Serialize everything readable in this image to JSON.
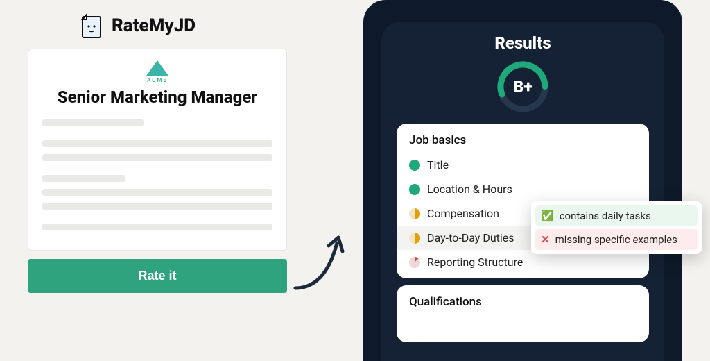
{
  "brand": {
    "name": "RateMyJD"
  },
  "jd": {
    "company": "ACME",
    "title": "Senior Marketing Manager"
  },
  "rate_button": "Rate it",
  "results": {
    "title": "Results",
    "grade": "B+",
    "sections": [
      {
        "title": "Job basics",
        "items": [
          {
            "label": "Title",
            "status": "full"
          },
          {
            "label": "Location & Hours",
            "status": "full"
          },
          {
            "label": "Compensation",
            "status": "partial"
          },
          {
            "label": "Day-to-Day Duties",
            "status": "partial",
            "highlighted": true
          },
          {
            "label": "Reporting Structure",
            "status": "low"
          }
        ]
      },
      {
        "title": "Qualifications"
      }
    ]
  },
  "tooltip": {
    "ok": "contains daily tasks",
    "bad": "missing specific examples"
  }
}
